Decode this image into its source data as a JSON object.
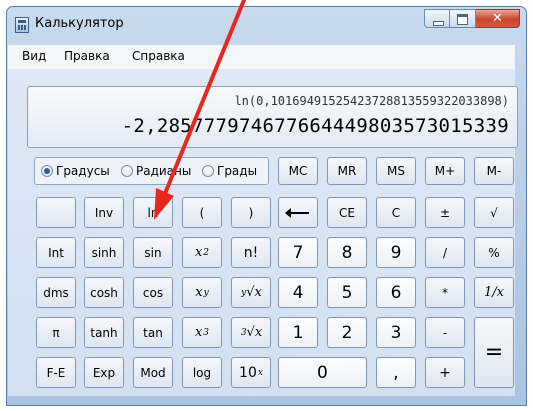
{
  "window": {
    "title": "Калькулятор"
  },
  "menu": [
    "Вид",
    "Правка",
    "Справка"
  ],
  "display": {
    "expression": "ln(0,1016949152542372881355932203389​8)",
    "result": "-2,2857779746776644498035730153​39"
  },
  "angles": {
    "options": [
      "Градусы",
      "Радианы",
      "Грады"
    ],
    "selected": "Градусы"
  },
  "memory_keys": [
    "MC",
    "MR",
    "MS",
    "M+",
    "M-"
  ],
  "keys": {
    "inv": "Inv",
    "ln": "ln",
    "lparen": "(",
    "rparen": ")",
    "ce": "CE",
    "c": "C",
    "plusminus": "±",
    "sqrt": "√",
    "int": "Int",
    "sinh": "sinh",
    "sin": "sin",
    "x": "x",
    "sq_exp": "2",
    "fact": "n!",
    "n7": "7",
    "n8": "8",
    "n9": "9",
    "div": "/",
    "pct": "%",
    "dms": "dms",
    "cosh": "cosh",
    "cos": "cos",
    "pow_exp": "y",
    "yroot_idx": "y",
    "root": "√",
    "n4": "4",
    "n5": "5",
    "n6": "6",
    "mul": "*",
    "recip": "1/x",
    "pi": "π",
    "tanh": "tanh",
    "tan": "tan",
    "cube_exp": "3",
    "cube_idx": "3",
    "n1": "1",
    "n2": "2",
    "n3": "3",
    "sub": "-",
    "eq": "=",
    "fe": "F-E",
    "exp": "Exp",
    "mod": "Mod",
    "log": "log",
    "ten": "10",
    "ten_exp": "x",
    "n0": "0",
    "dot": ",",
    "add": "+"
  },
  "annotation": {
    "color": "#e8271d"
  }
}
